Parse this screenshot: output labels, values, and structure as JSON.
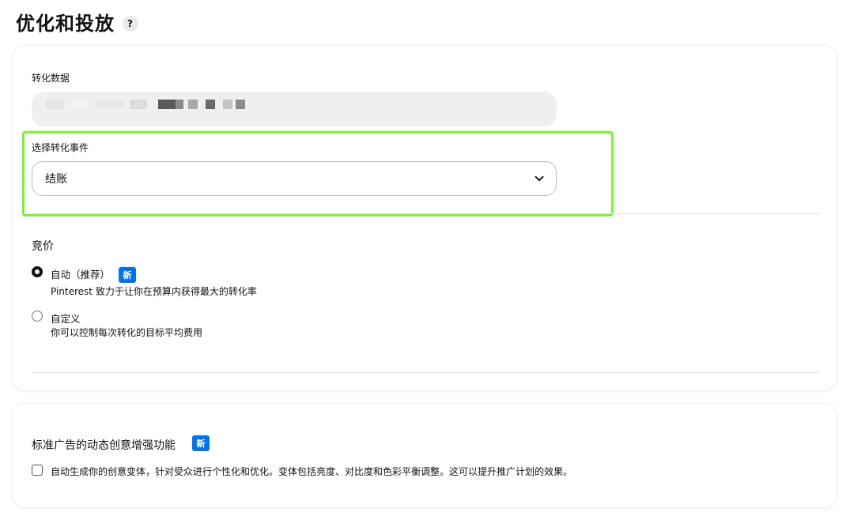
{
  "page": {
    "title": "优化和投放",
    "help_icon_label": "?"
  },
  "conversion_data": {
    "label": "转化数据"
  },
  "conversion_event": {
    "label": "选择转化事件",
    "selected_value": "结账"
  },
  "bidding": {
    "heading": "竞价",
    "options": [
      {
        "title": "自动（推荐）",
        "badge": "新",
        "description": "Pinterest 致力于让你在预算内获得最大的转化率",
        "selected": true
      },
      {
        "title": "自定义",
        "description": "你可以控制每次转化的目标平均费用",
        "selected": false
      }
    ]
  },
  "dynamic_creative": {
    "heading": "标准广告的动态创意增强功能",
    "badge": "新",
    "checkbox_label": "自动生成你的创意变体，针对受众进行个性化和优化。变体包括亮度、对比度和色彩平衡调整。这可以提升推广计划的效果。",
    "checked": false
  },
  "colors": {
    "highlight": "#7cf03a",
    "badge": "#0074e8"
  }
}
